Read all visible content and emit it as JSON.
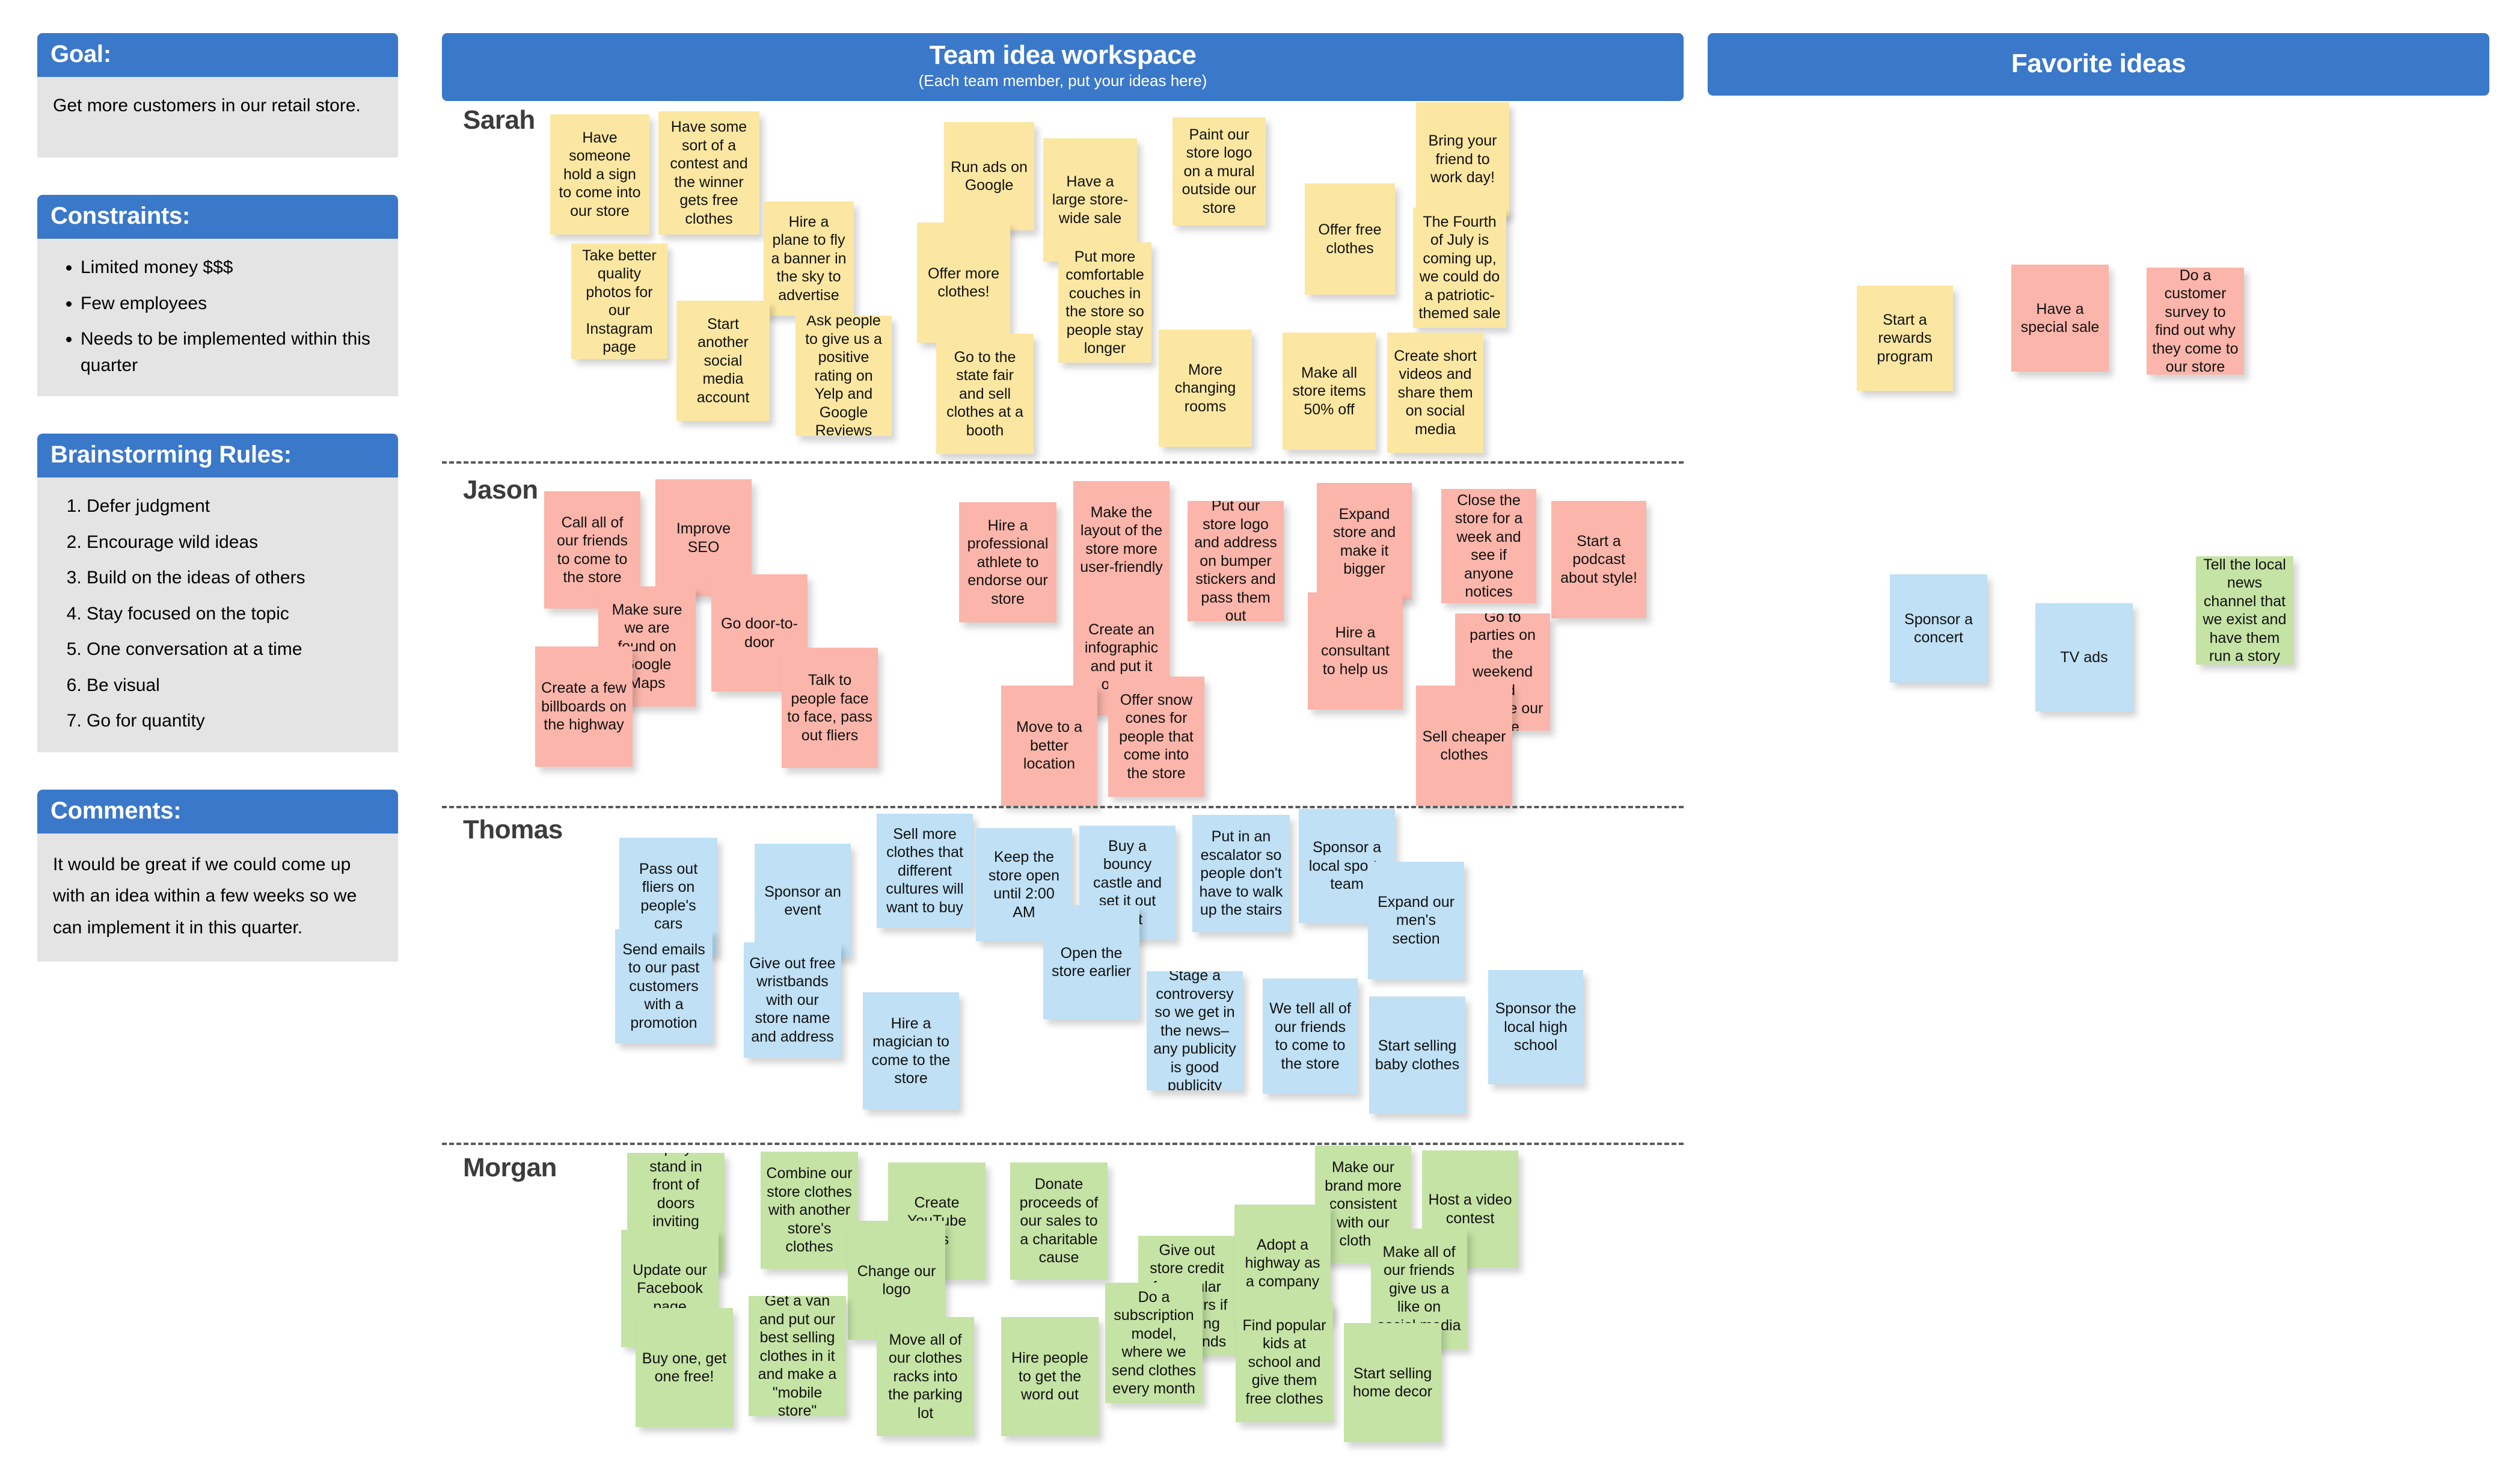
{
  "sidebar": {
    "goal": {
      "header": "Goal:",
      "text": "Get more customers in our retail store."
    },
    "constraints": {
      "header": "Constraints:",
      "items": [
        "Limited money $$$",
        "Few employees",
        "Needs to be implemented within this quarter"
      ]
    },
    "rules": {
      "header": "Brainstorming Rules:",
      "items": [
        "Defer judgment",
        "Encourage wild ideas",
        "Build on the ideas of others",
        "Stay focused on the topic",
        "One conversation at a time",
        "Be visual",
        "Go for quantity"
      ]
    },
    "comments": {
      "header": "Comments:",
      "text": "It would be great if we could come up with an idea within a few weeks so we can implement it in this quarter."
    }
  },
  "board": {
    "title": "Team idea workspace",
    "subtitle": "(Each team member, put your ideas here)",
    "sections": [
      {
        "name": "Sarah",
        "color": "yellow"
      },
      {
        "name": "Jason",
        "color": "pink"
      },
      {
        "name": "Thomas",
        "color": "blue"
      },
      {
        "name": "Morgan",
        "color": "green"
      }
    ],
    "notes": {
      "sarah": [
        "Have someone hold a sign to come into our store",
        "Have some sort of a contest and the winner gets free clothes",
        "Run ads on Google",
        "Have a large store-wide sale",
        "Paint our store logo on a mural outside our store",
        "Bring your friend to work day!",
        "Hire a plane to fly a banner in the sky to advertise",
        "Offer free clothes",
        "The Fourth of July is coming up, we could do a patriotic-themed sale",
        "Take better quality photos for our Instagram page",
        "Offer more clothes!",
        "Put more comfortable couches in the store so people stay longer",
        "Start another social media account",
        "Ask people to give us a positive rating on Yelp and Google Reviews",
        "Go to the state fair and sell clothes at a booth",
        "More changing rooms",
        "Make all store items 50% off",
        "Create short videos and share them on social media"
      ],
      "jason": [
        "Call all of our friends to come to the store",
        "Improve SEO",
        "Hire a professional athlete to endorse our store",
        "Make the layout of the store more user-friendly",
        "Put our store logo and address on bumper stickers and pass them out",
        "Expand store and make it bigger",
        "Close the store for a week and see if anyone notices",
        "Start a podcast about style!",
        "Make sure we are found on Google Maps",
        "Go door-to-door",
        "Create an infographic and put it online",
        "Hire a consultant to help us",
        "Go to parties on the weekend and promote our store",
        "Create a few billboards on the highway",
        "Talk to people face to face, pass out fliers",
        "Move to a better location",
        "Offer snow cones for people that come into the store",
        "Sell cheaper clothes"
      ],
      "thomas": [
        "Pass out fliers on people's cars",
        "Sponsor an event",
        "Sell more clothes that different cultures will want to buy",
        "Keep the store open until 2:00 AM",
        "Buy a bouncy castle and set it out front",
        "Put in an escalator so people don't have to walk up the stairs",
        "Sponsor a local sports team",
        "Open the store earlier",
        "Expand our men's section",
        "Send emails to our past customers with a promotion",
        "Give out free wristbands with our store name and address",
        "Hire a magician to come to the store",
        "Stage a controversy so we get in the news–any publicity is good publicity",
        "We tell all of our friends to come to the store",
        "Start selling baby clothes",
        "Sponsor the local high school"
      ],
      "morgan": [
        "Have an employee stand in front of doors inviting people to come see our merchandise",
        "Combine our store clothes with another store's clothes",
        "Create YouTube ads",
        "Donate proceeds of our sales to a charitable cause",
        "Make our brand more consistent with our clothes",
        "Host a video contest",
        "Update our Facebook page",
        "Change our logo",
        "Give out store credit for regular customers if they bring their friends",
        "Adopt a highway as a company",
        "Make all of our friends give us a like on social media",
        "Buy one, get one free!",
        "Get a van and put our best selling clothes in it and make a \"mobile store\"",
        "Move all of our clothes racks into the parking lot",
        "Hire people to get the word out",
        "Do a subscription model, where we send clothes every month",
        "Find popular kids at school and give them free clothes",
        "Start selling home decor"
      ]
    }
  },
  "favorites": {
    "header": "Favorite ideas",
    "notes": [
      {
        "text": "Start a rewards program",
        "color": "yellow"
      },
      {
        "text": "Have a special sale",
        "color": "pink"
      },
      {
        "text": "Do a customer survey to find out why they come to our store",
        "color": "pink"
      },
      {
        "text": "Sponsor a concert",
        "color": "blue"
      },
      {
        "text": "TV ads",
        "color": "blue"
      },
      {
        "text": "Tell the local news channel that we exist and have them run a story",
        "color": "green"
      }
    ]
  },
  "colors": {
    "accent": "#3A78C9",
    "panel_body": "#E4E4E4",
    "note_yellow": "#FCE7A2",
    "note_pink": "#FBB5AA",
    "note_blue": "#BFE0F5",
    "note_green": "#C5E3A5"
  }
}
